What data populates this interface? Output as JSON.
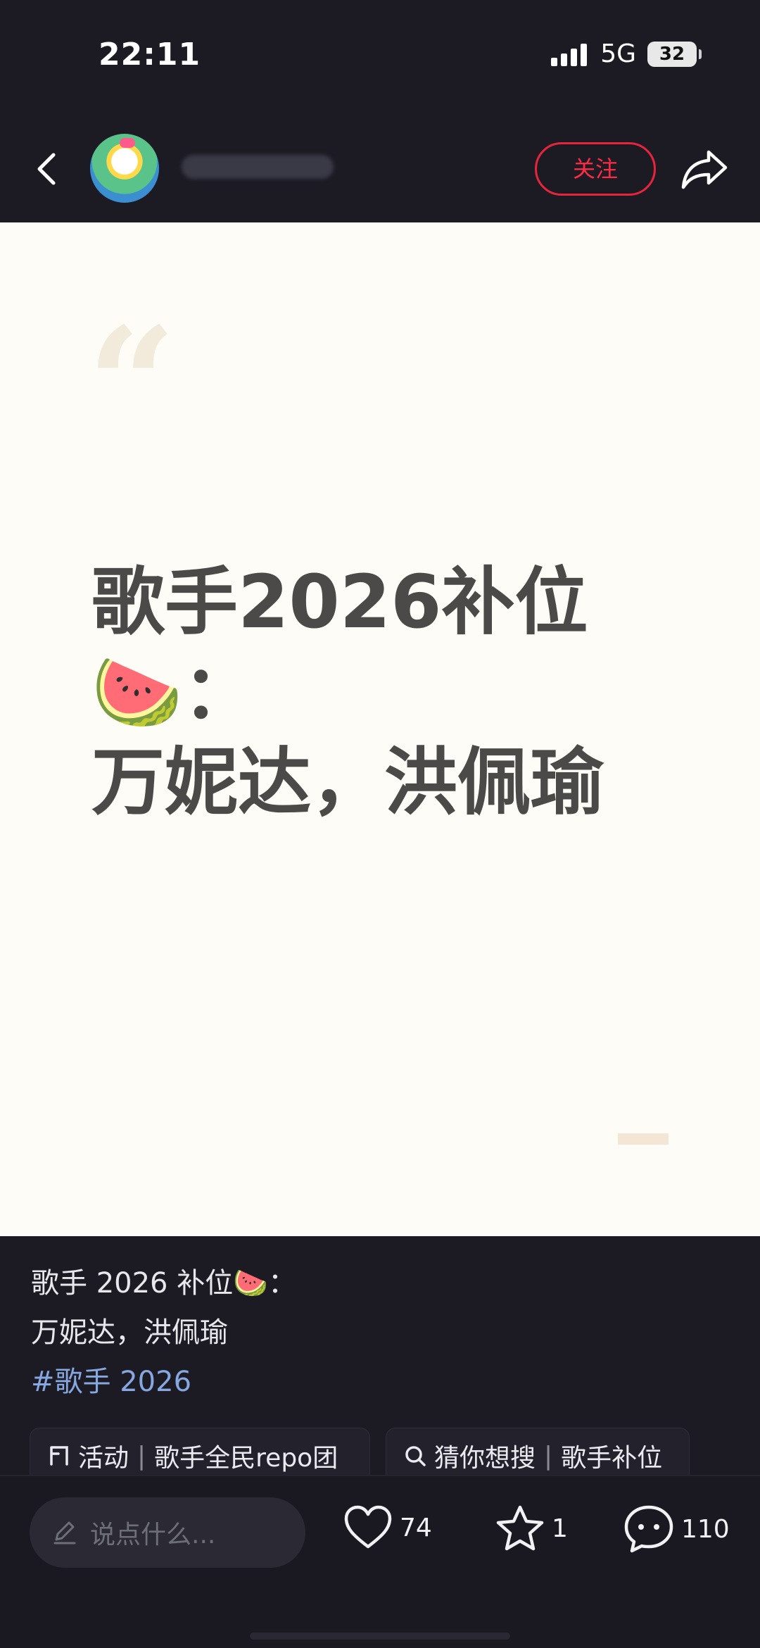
{
  "status_bar": {
    "time": "22:11",
    "network": "5G",
    "battery": "32"
  },
  "nav": {
    "follow_label": "关注"
  },
  "image": {
    "quote_mark": "“",
    "line1": "歌手2026补位",
    "line2": "🍉：",
    "line3": "万妮达，洪佩瑜"
  },
  "caption": {
    "line1": "歌手 2026 补位🍉：",
    "line2": "万妮达，洪佩瑜",
    "hashtag": "#歌手 2026"
  },
  "chips": [
    {
      "icon": "activity-icon",
      "label": "活动",
      "value": "歌手全民repo团"
    },
    {
      "icon": "search-icon",
      "label": "猜你想搜",
      "value": "歌手补位"
    }
  ],
  "bottom_bar": {
    "comment_placeholder": "说点什么...",
    "likes": "74",
    "favorites": "1",
    "comments": "110"
  }
}
